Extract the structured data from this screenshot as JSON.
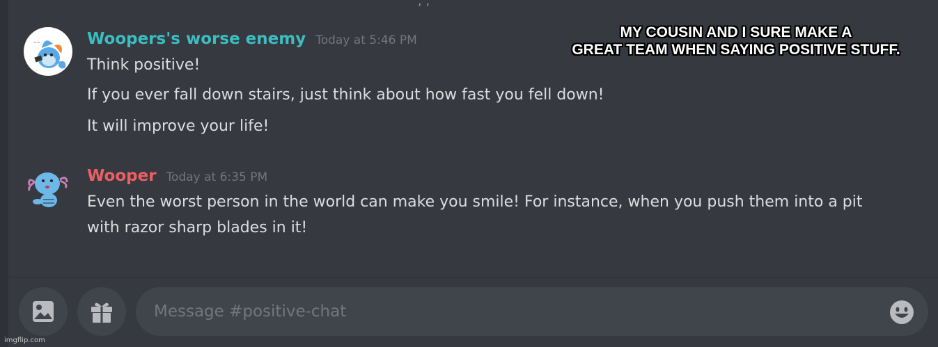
{
  "caption": {
    "line1": "MY COUSIN AND I SURE MAKE A",
    "line2": "GREAT TEAM WHEN SAYING POSITIVE STUFF."
  },
  "messages": [
    {
      "author": "Woopers's worse enemy",
      "author_color": "#3cbec1",
      "timestamp": "Today at 5:46 PM",
      "lines": [
        "Think positive!",
        "If you ever fall down stairs, just think about how fast you fell down!",
        "It will improve your life!"
      ]
    },
    {
      "author": "Wooper",
      "author_color": "#ec5f62",
      "timestamp": "Today at 6:35 PM",
      "lines": [
        "Even the worst person in the world can make you smile! For instance, when you push them into a pit",
        "with razor sharp blades in it!"
      ]
    }
  ],
  "input": {
    "placeholder": "Message #positive-chat"
  },
  "buttons": {
    "upload_icon": "image-icon",
    "gift_icon": "gift-icon",
    "emoji_icon": "emoji-icon"
  },
  "watermark": "imgflip.com"
}
